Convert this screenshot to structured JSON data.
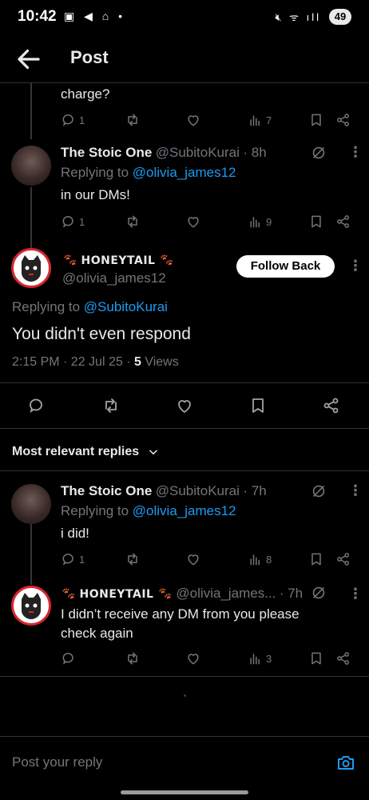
{
  "status": {
    "time": "10:42",
    "battery": "49"
  },
  "header": {
    "title": "Post"
  },
  "tweet_prev": {
    "text": "charge?",
    "replies": "1",
    "views": "7"
  },
  "tweet_reply1": {
    "name": "The Stoic One",
    "handle": "@SubitoKurai",
    "time": "· 8h",
    "replying_prefix": "Replying to ",
    "replying_to": "@olivia_james12",
    "text": "in our DMs!",
    "replies": "1",
    "views": "9"
  },
  "main_tweet": {
    "name": "HONEYTAIL",
    "handle": "@olivia_james12",
    "follow_label": "Follow Back",
    "replying_prefix": "Replying to ",
    "replying_to": "@SubitoKurai",
    "text": "You didn't even respond",
    "meta_prefix": "2:15 PM · 22 Jul 25 · ",
    "views_count": "5",
    "views_label": " Views"
  },
  "sort": {
    "label": "Most relevant replies"
  },
  "reply_a": {
    "name": "The Stoic One",
    "handle": "@SubitoKurai",
    "time": "· 7h",
    "replying_prefix": "Replying to ",
    "replying_to": "@olivia_james12",
    "text": "i did!",
    "replies": "1",
    "views": "8"
  },
  "reply_b": {
    "name": "HONEYTAIL",
    "handle": "@olivia_james...",
    "time": "· 7h",
    "text_line1": "I didn’t receive any DM from you please",
    "text_line2": "check again",
    "views": "3"
  },
  "compose": {
    "placeholder": "Post your reply"
  },
  "colors": {
    "accent": "#1d9bf0",
    "muted": "#71767b",
    "background": "#000000",
    "paw": "#e8622c"
  }
}
